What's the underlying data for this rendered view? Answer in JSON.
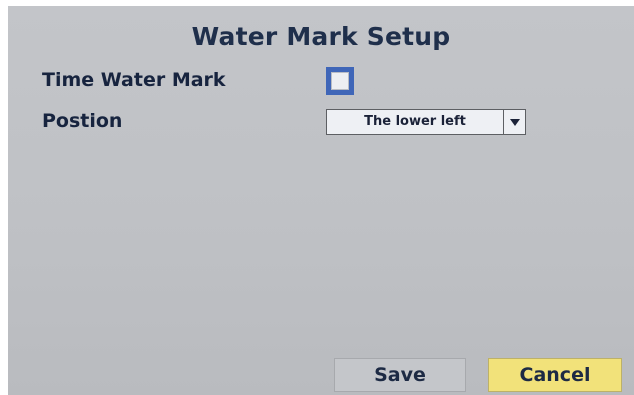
{
  "dialog": {
    "title": "Water Mark Setup",
    "time_water_mark": {
      "label": "Time Water Mark",
      "checked": false
    },
    "position": {
      "label": "Postion",
      "selected": "The lower left"
    },
    "buttons": {
      "save": "Save",
      "cancel": "Cancel"
    }
  },
  "colors": {
    "background": "#c0c2c6",
    "title_text": "#1f2f4b",
    "label_text": "#17243f",
    "checkbox_focus": "#3f66b8",
    "cancel_button": "#f2e27a",
    "save_button": "#c4c6ca"
  }
}
